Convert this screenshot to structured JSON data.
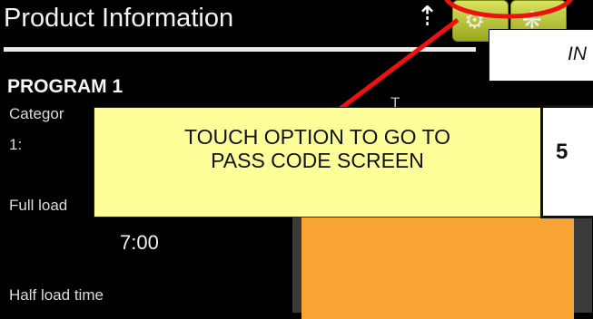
{
  "header": {
    "title": "Product Information",
    "usb_icon": "usb-icon",
    "buttons": [
      {
        "icon": "settings-icon",
        "glyph": "⚙"
      },
      {
        "icon": "fan-icon",
        "glyph": "❋"
      }
    ]
  },
  "program": {
    "name": "PROGRAM 1",
    "category_label": "Categor",
    "category_value": "1:",
    "secondary_label": "T",
    "full_load_label": "Full load",
    "full_load_value": "7:00",
    "half_load_label": "Half load time"
  },
  "annotations": {
    "callout_text": "TOUCH OPTION TO GO TO PASS CODE SCREEN",
    "in_box_text": "IN",
    "step_box_text": "5",
    "arrow_color": "#ee1111",
    "callout_color": "#ffff99"
  },
  "colors": {
    "accent_green": "#b5c23a",
    "orange_panel": "#f7a434"
  }
}
